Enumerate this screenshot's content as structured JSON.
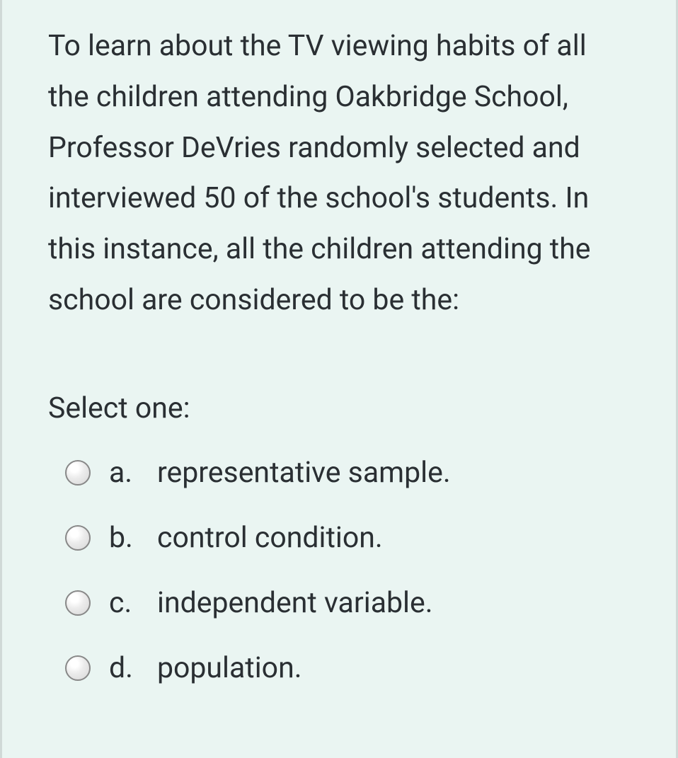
{
  "question": {
    "text": "To learn about the TV viewing habits of all the children attending Oakbridge School, Professor DeVries randomly selected and interviewed 50 of the school's students. In this instance, all the children attending the school are considered to be the:",
    "prompt": "Select one:",
    "options": [
      {
        "letter": "a.",
        "text": "representative sample."
      },
      {
        "letter": "b.",
        "text": "control condition."
      },
      {
        "letter": "c.",
        "text": "independent variable."
      },
      {
        "letter": "d.",
        "text": "population."
      }
    ]
  }
}
